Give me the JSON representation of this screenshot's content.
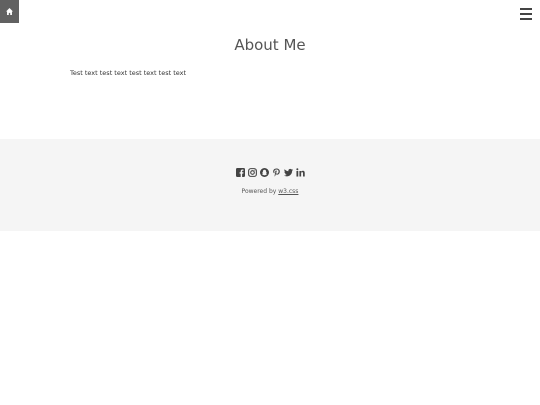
{
  "nav": {
    "home_icon": "home-icon",
    "menu_icon": "hamburger-menu-icon"
  },
  "main": {
    "title": "About Me",
    "body": "Test text test text test text test text"
  },
  "footer": {
    "social_icons": [
      "facebook-icon",
      "instagram-icon",
      "snapchat-icon",
      "pinterest-icon",
      "twitter-icon",
      "linkedin-icon"
    ],
    "powered_prefix": "Powered by",
    "powered_link": "w3.css"
  },
  "colors": {
    "home_button_bg": "#616161",
    "footer_bg": "#f5f5f5",
    "title_text": "#555555"
  }
}
